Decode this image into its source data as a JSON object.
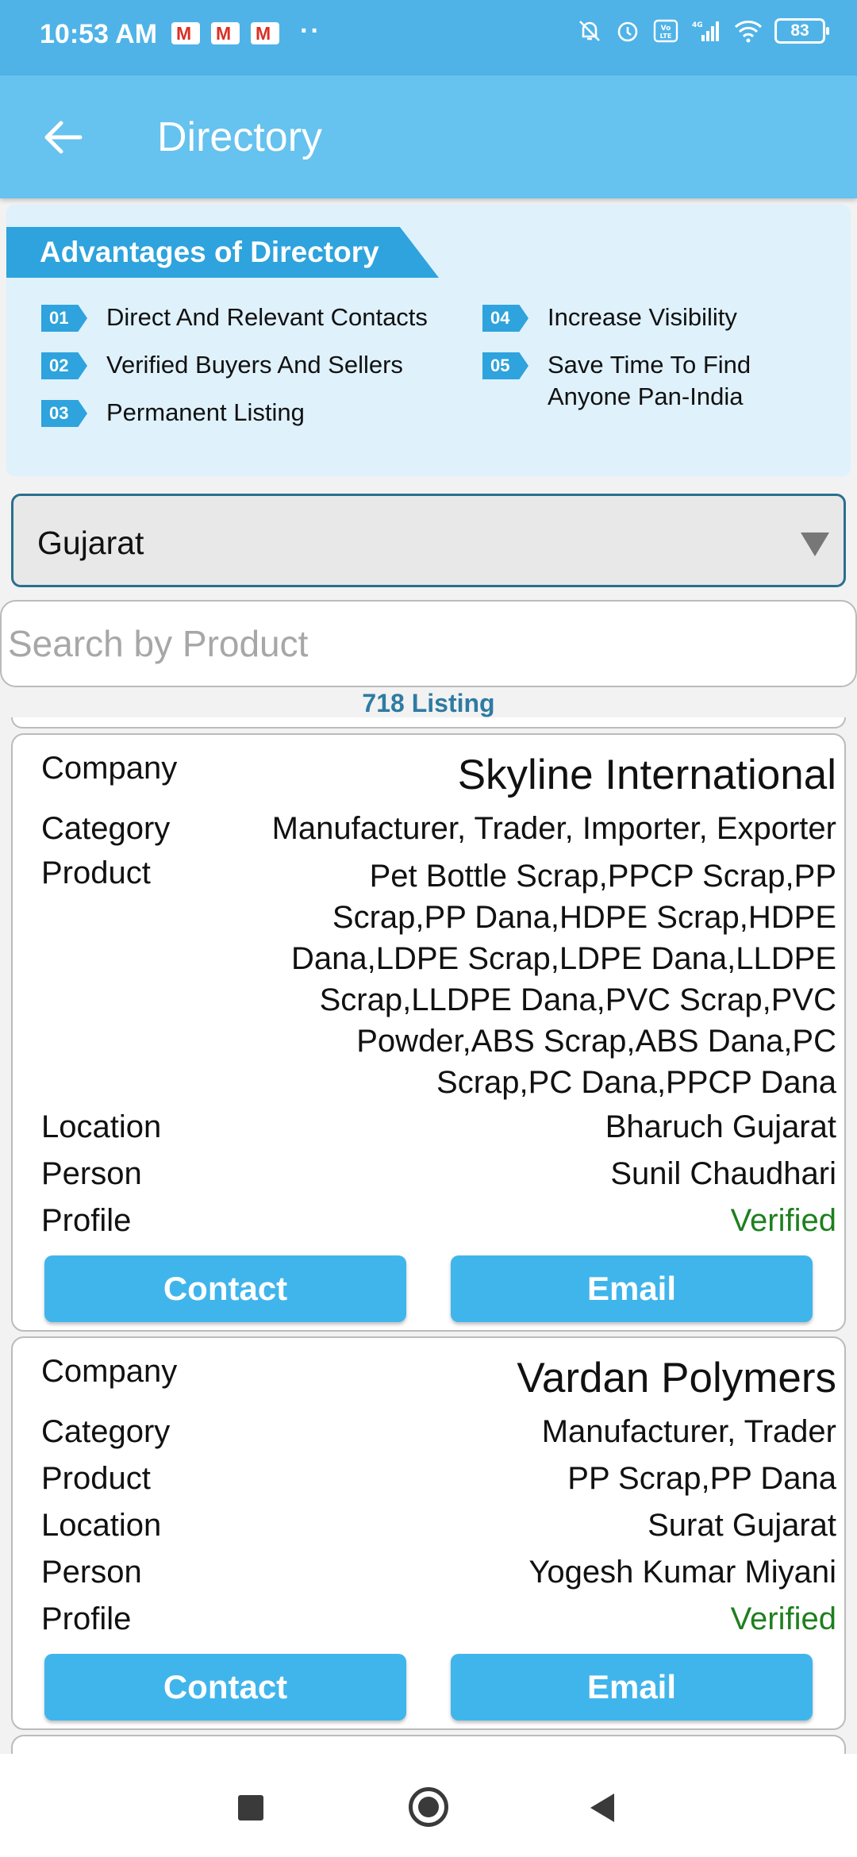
{
  "status_bar": {
    "time": "10:53 AM",
    "notification_icons": [
      "gmail-icon",
      "gmail-icon",
      "gmail-icon"
    ],
    "more": "··",
    "battery": "83"
  },
  "app_bar": {
    "title": "Directory"
  },
  "advantages": {
    "title": "Advantages of Directory",
    "items_left": [
      {
        "num": "01",
        "text": "Direct And Relevant Contacts"
      },
      {
        "num": "02",
        "text": "Verified Buyers And Sellers"
      },
      {
        "num": "03",
        "text": "Permanent Listing"
      }
    ],
    "items_right": [
      {
        "num": "04",
        "text": "Increase Visibility"
      },
      {
        "num": "05",
        "text": "Save Time To Find Anyone Pan-India"
      }
    ]
  },
  "filter": {
    "state": "Gujarat"
  },
  "search": {
    "placeholder": "Search by Product"
  },
  "listing_count": "718 Listing",
  "labels": {
    "company": "Company",
    "category": "Category",
    "product": "Product",
    "location": "Location",
    "person": "Person",
    "profile": "Profile",
    "contact": "Contact",
    "email": "Email"
  },
  "listings": [
    {
      "company": "Skyline International",
      "category": "Manufacturer, Trader, Importer, Exporter",
      "product": "Pet Bottle Scrap,PPCP Scrap,PP Scrap,PP Dana,HDPE Scrap,HDPE Dana,LDPE Scrap,LDPE Dana,LLDPE Scrap,LLDPE Dana,PVC Scrap,PVC Powder,ABS Scrap,ABS Dana,PC Scrap,PC Dana,PPCP Dana",
      "location": "Bharuch Gujarat",
      "person": "Sunil Chaudhari",
      "profile": "Verified"
    },
    {
      "company": "Vardan Polymers",
      "category": "Manufacturer, Trader",
      "product": "PP Scrap,PP Dana",
      "location": "Surat Gujarat",
      "person": "Yogesh Kumar Miyani",
      "profile": "Verified"
    }
  ],
  "colors": {
    "status_bar": "#4fb3e8",
    "app_bar": "#66c2ee",
    "accent": "#2ea3dd",
    "button": "#40b5ec",
    "verified": "#1e7f1e"
  }
}
